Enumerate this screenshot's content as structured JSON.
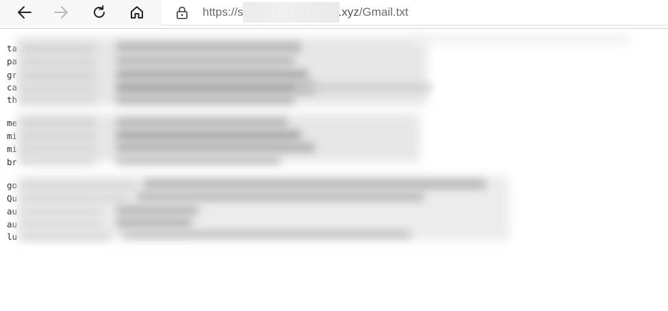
{
  "toolbar": {
    "back_icon": "arrow-left-icon",
    "forward_icon": "arrow-right-icon",
    "reload_icon": "reload-icon",
    "home_icon": "home-icon"
  },
  "address_bar": {
    "lock_icon": "lock-icon",
    "url_prefix": "https://s",
    "url_host_suffix": ".xyz",
    "url_path": "/Gmail.txt"
  },
  "content": {
    "lines": [
      {
        "visible": "ta"
      },
      {
        "visible": "pa"
      },
      {
        "visible": "gr"
      },
      {
        "visible": "ca"
      },
      {
        "visible": "th"
      },
      {
        "visible": ""
      },
      {
        "visible": "me"
      },
      {
        "visible": "mi"
      },
      {
        "visible": "mi"
      },
      {
        "visible": "br"
      },
      {
        "visible": ""
      },
      {
        "visible": "go"
      },
      {
        "visible": "Qu"
      },
      {
        "visible": "au"
      },
      {
        "visible": "au"
      },
      {
        "visible": "lu"
      }
    ]
  }
}
